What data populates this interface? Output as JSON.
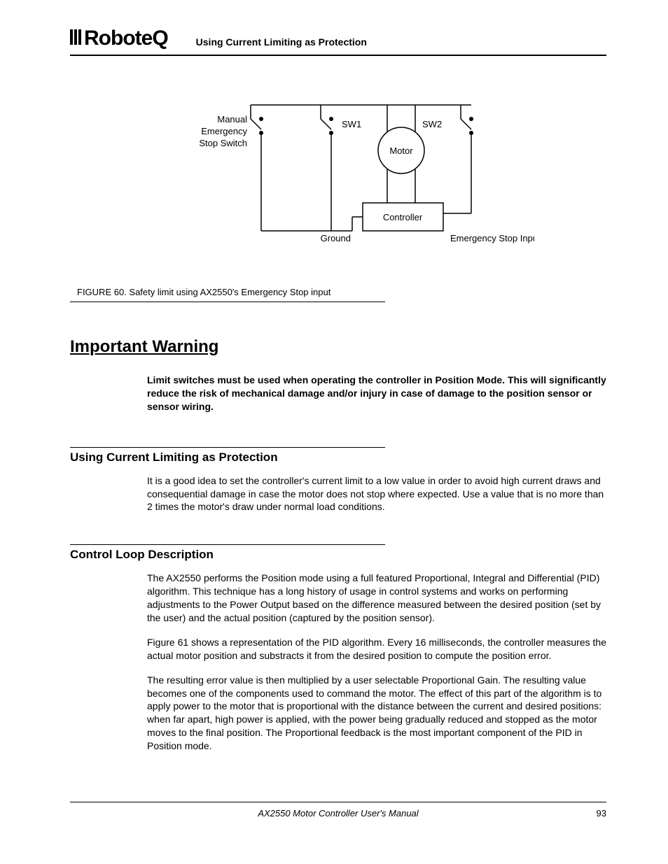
{
  "header": {
    "logo_text": "RoboteQ",
    "running_title": "Using Current Limiting as Protection"
  },
  "diagram": {
    "labels": {
      "manual_stop_l1": "Manual",
      "manual_stop_l2": "Emergency",
      "manual_stop_l3": "Stop Switch",
      "sw1": "SW1",
      "sw2": "SW2",
      "motor": "Motor",
      "controller": "Controller",
      "ground": "Ground",
      "estop_input": "Emergency Stop Input"
    }
  },
  "figure_caption": "FIGURE 60.  Safety limit using AX2550's Emergency Stop input",
  "warning": {
    "heading": "Important Warning",
    "body": "Limit switches must be used when operating the controller in Position Mode. This will significantly reduce the risk of mechanical damage and/or injury in case of damage to the position sensor or sensor wiring."
  },
  "section_current": {
    "heading": "Using Current Limiting as Protection",
    "body": "It is a good idea to set the controller's current limit to a low value in order to avoid high current draws and consequential damage in case the motor does not stop where expected. Use a value that is no more than 2 times the motor's draw under normal load conditions."
  },
  "section_loop": {
    "heading": "Control Loop Description",
    "p1": "The AX2550 performs the Position mode using a full featured Proportional, Integral and Differential (PID) algorithm. This technique has a long history of usage in control systems and works on performing adjustments to the Power Output based on the difference measured between the desired position (set by the user) and the actual position (captured by the position sensor).",
    "p2": "Figure 61 shows a representation of the PID algorithm. Every 16 milliseconds, the controller measures the actual motor position and substracts it from the desired position to compute the position error.",
    "p3": "The resulting error value is then multiplied by a user selectable Proportional Gain. The resulting value becomes one of the components used to command the motor. The effect of this part of the algorithm is to apply power to the motor that is proportional with the distance between the current and desired positions: when far apart, high power is applied, with the power being gradually reduced and stopped as the motor moves to the final position. The Proportional feedback is the most important component of the PID in Position mode."
  },
  "footer": {
    "manual_title": "AX2550 Motor Controller User's Manual",
    "page_number": "93"
  }
}
